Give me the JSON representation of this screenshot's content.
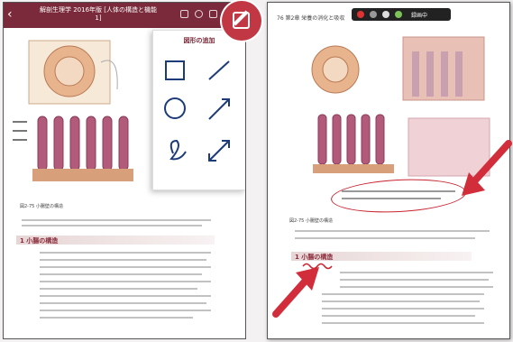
{
  "left_page": {
    "toolbar": {
      "back_glyph": "‹",
      "title_line1": "解剖生理学 2016年版 [人体の構造と機能",
      "title_line2": "1]"
    },
    "section_caption": "図2-75  小腸壁の構造",
    "section_title": "1 小腸の構造",
    "draw_panel": {
      "title": "図形の追加",
      "tools": [
        "rectangle-tool",
        "line-tool",
        "circle-tool",
        "arrow-tool",
        "freehand-tool",
        "double-arrow-tool"
      ]
    }
  },
  "right_page": {
    "page_number": "76  第2章  栄養の消化と吸収",
    "recording_bar_label": "録画中",
    "section_caption": "図2-75  小腸壁の構造",
    "section_title": "1 小腸の構造",
    "annotation_color": "#c8232f"
  },
  "colors": {
    "toolbar": "#7a2a3a",
    "accent_red": "#c23744"
  }
}
